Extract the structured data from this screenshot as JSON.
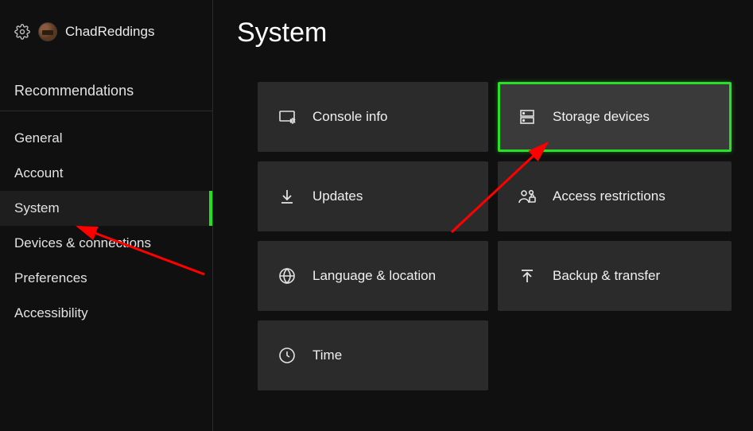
{
  "profile": {
    "username": "ChadReddings"
  },
  "sidebar": {
    "section_header": "Recommendations",
    "items": [
      {
        "label": "General",
        "active": false
      },
      {
        "label": "Account",
        "active": false
      },
      {
        "label": "System",
        "active": true
      },
      {
        "label": "Devices & connections",
        "active": false
      },
      {
        "label": "Preferences",
        "active": false
      },
      {
        "label": "Accessibility",
        "active": false
      }
    ]
  },
  "page": {
    "title": "System"
  },
  "tiles": [
    {
      "id": "console-info",
      "label": "Console info",
      "icon": "monitor-gear-icon",
      "highlight": false
    },
    {
      "id": "storage-devices",
      "label": "Storage devices",
      "icon": "storage-icon",
      "highlight": true
    },
    {
      "id": "updates",
      "label": "Updates",
      "icon": "download-icon",
      "highlight": false
    },
    {
      "id": "access-restrictions",
      "label": "Access restrictions",
      "icon": "people-lock-icon",
      "highlight": false
    },
    {
      "id": "language-location",
      "label": "Language & location",
      "icon": "globe-icon",
      "highlight": false
    },
    {
      "id": "backup-transfer",
      "label": "Backup & transfer",
      "icon": "upload-icon",
      "highlight": false
    },
    {
      "id": "time",
      "label": "Time",
      "icon": "clock-icon",
      "highlight": false
    }
  ],
  "colors": {
    "accent": "#27e027",
    "tile_bg": "#2b2b2b",
    "bg": "#101010",
    "annotation_arrow": "#ff0000"
  }
}
